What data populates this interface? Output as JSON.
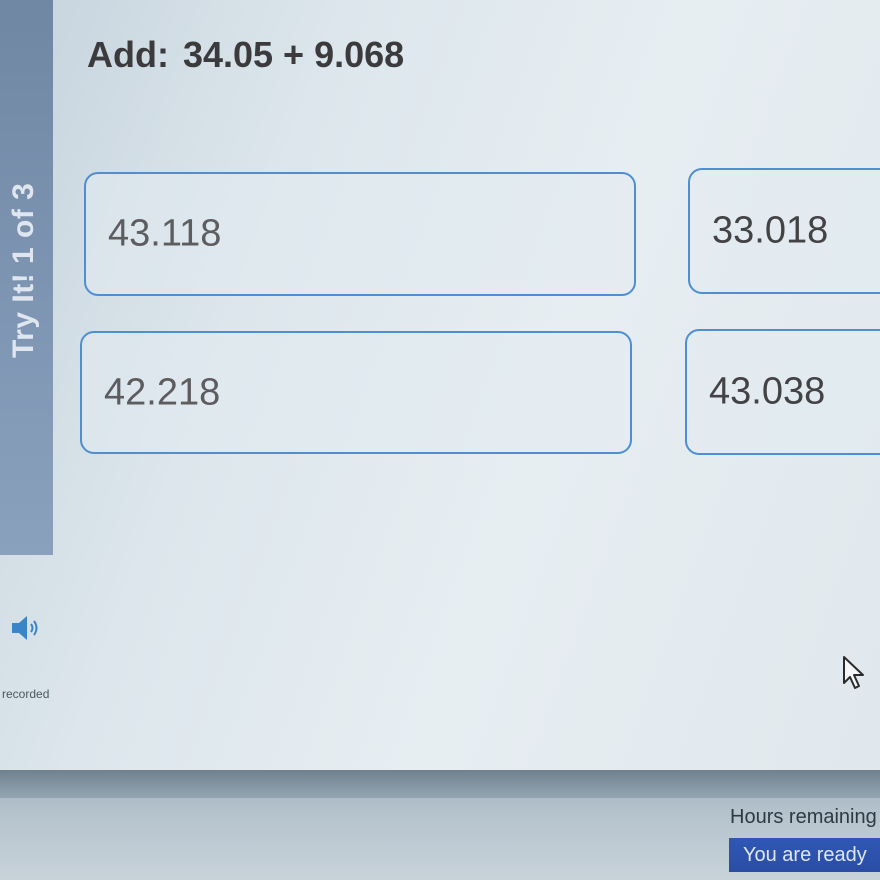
{
  "side_tab": {
    "label": "Try It! 1 of 3"
  },
  "question": {
    "prefix": "Add:",
    "expression": "34.05 + 9.068"
  },
  "choices": [
    {
      "label": "43.118"
    },
    {
      "label": "33.018"
    },
    {
      "label": "42.218"
    },
    {
      "label": "43.038"
    }
  ],
  "audio": {
    "icon": "speaker-icon",
    "status": "recorded"
  },
  "footer": {
    "hours_label": "Hours remaining",
    "ready_text": "You are ready"
  },
  "colors": {
    "choice_border": "#4e8fd3",
    "side_tab": "#7f97b4",
    "ready_banner": "#2f57b5",
    "speaker": "#3a85c8"
  }
}
